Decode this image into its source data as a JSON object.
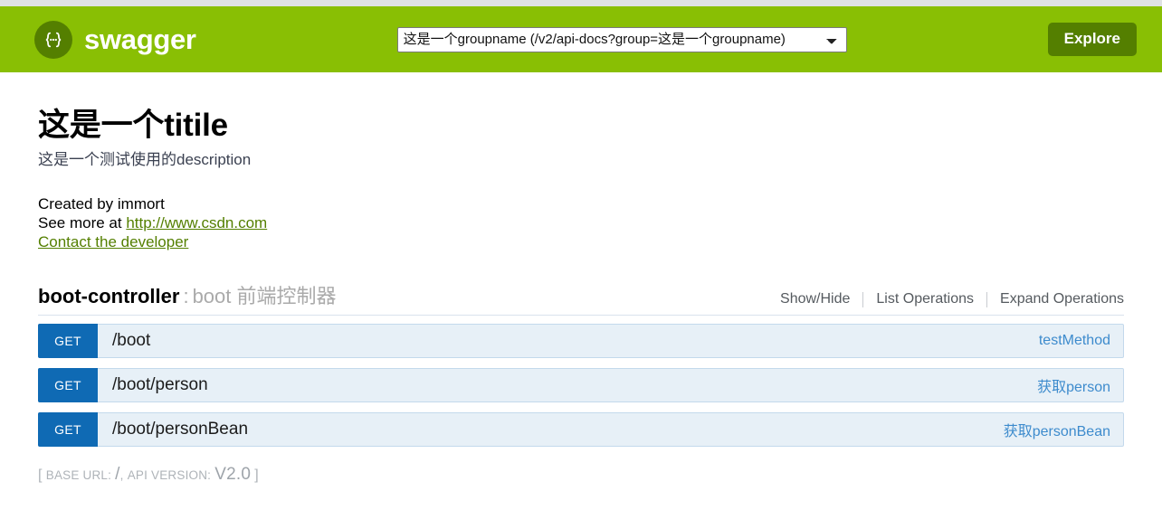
{
  "header": {
    "brand_name": "swagger",
    "logo_icon": "swagger-braces-icon",
    "api_select": {
      "selected": "这是一个groupname (/v2/api-docs?group=这是一个groupname)",
      "options": [
        "这是一个groupname (/v2/api-docs?group=这是一个groupname)"
      ]
    },
    "explore_label": "Explore",
    "bar_color": "#89bf04",
    "explore_color": "#547f00"
  },
  "info": {
    "title": "这是一个titile",
    "description": "这是一个测试使用的description",
    "created_by": "Created by immort",
    "see_more_prefix": "See more at ",
    "see_more_link": "http://www.csdn.com",
    "contact_link": "Contact the developer",
    "link_color": "#547f00"
  },
  "resource": {
    "name": "boot-controller",
    "separator": ":",
    "subtitle": "boot 前端控制器",
    "options": [
      {
        "label": "Show/Hide"
      },
      {
        "label": "List Operations"
      },
      {
        "label": "Expand Operations"
      }
    ]
  },
  "operations": [
    {
      "method": "GET",
      "path": "/boot",
      "summary": "testMethod"
    },
    {
      "method": "GET",
      "path": "/boot/person",
      "summary": "获取person"
    },
    {
      "method": "GET",
      "path": "/boot/personBean",
      "summary": "获取personBean"
    }
  ],
  "footer": {
    "open_bracket": "[",
    "base_url_label": "BASE URL:",
    "base_url_value": "/",
    "comma": ",",
    "api_version_label": "API VERSION:",
    "api_version_value": "V2.0",
    "close_bracket": "]"
  },
  "colors": {
    "method_get": "#0f6ab4",
    "row_background": "#e7f0f7",
    "row_border": "#c3d9ec",
    "summary_text": "#3d8bcd"
  }
}
